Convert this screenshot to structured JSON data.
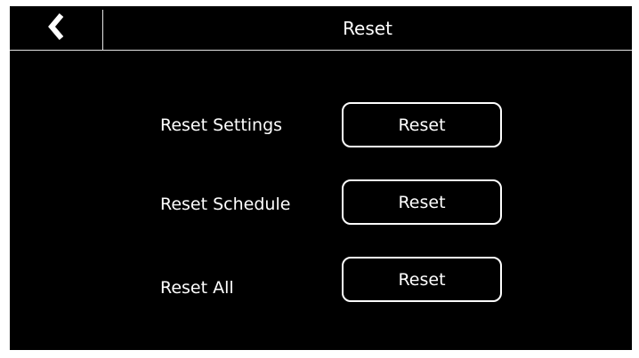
{
  "header": {
    "title": "Reset",
    "back_icon": "chevron-left-icon"
  },
  "rows": [
    {
      "label": "Reset Settings",
      "button_label": "Reset"
    },
    {
      "label": "Reset Schedule",
      "button_label": "Reset"
    },
    {
      "label": "Reset All",
      "button_label": "Reset"
    }
  ],
  "colors": {
    "background": "#000000",
    "foreground": "#ffffff"
  }
}
